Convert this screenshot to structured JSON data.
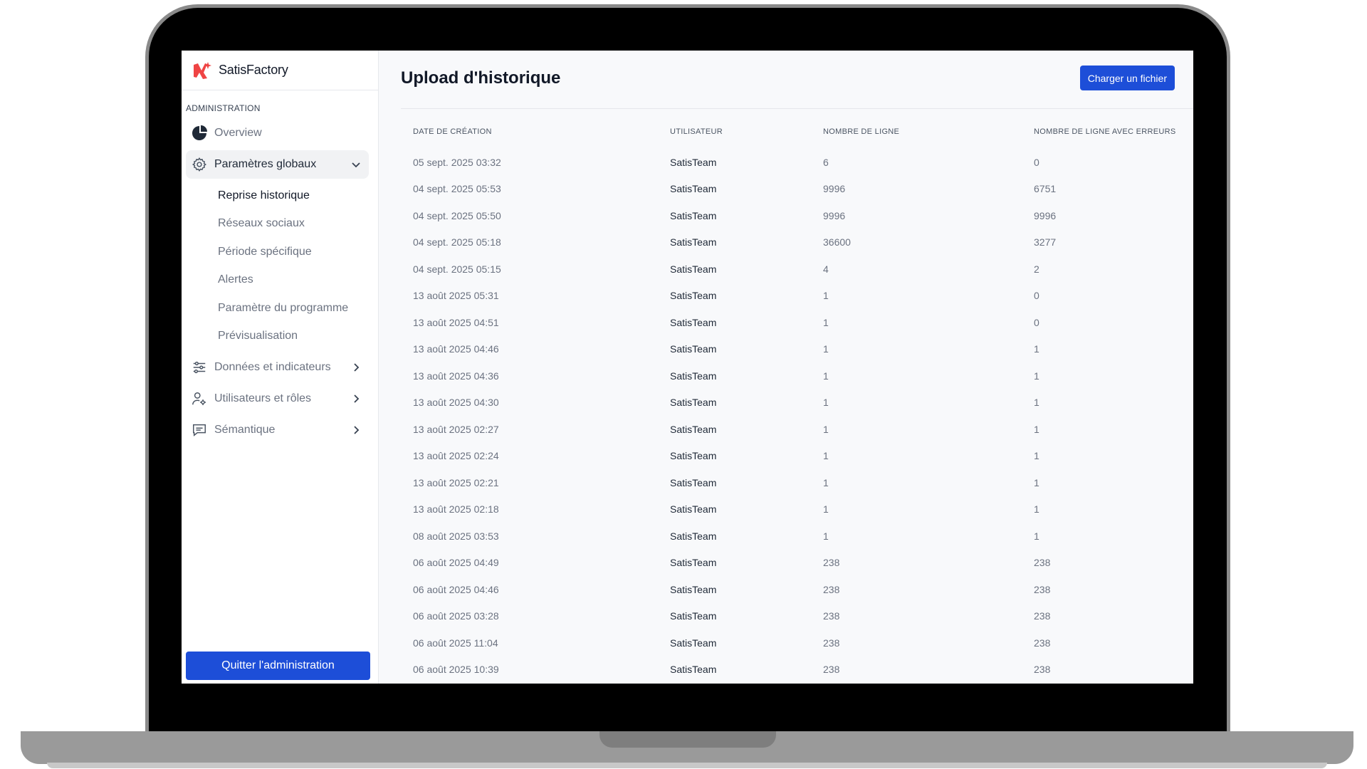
{
  "brand": {
    "name": "SatisFactory"
  },
  "sidebar": {
    "section_label": "ADMINISTRATION",
    "items": [
      {
        "label": "Overview",
        "icon": "pie-chart-icon"
      },
      {
        "label": "Paramètres globaux",
        "icon": "gear-icon",
        "expanded": true
      },
      {
        "label": "Données et indicateurs",
        "icon": "sliders-icon"
      },
      {
        "label": "Utilisateurs et rôles",
        "icon": "user-gear-icon"
      },
      {
        "label": "Sémantique",
        "icon": "chat-icon"
      }
    ],
    "subitems": [
      {
        "label": "Reprise historique",
        "current": true
      },
      {
        "label": "Réseaux sociaux"
      },
      {
        "label": "Période spécifique"
      },
      {
        "label": "Alertes"
      },
      {
        "label": "Paramètre du programme"
      },
      {
        "label": "Prévisualisation"
      }
    ],
    "quit_label": "Quitter l'administration"
  },
  "main": {
    "title": "Upload d'historique",
    "upload_label": "Charger un fichier",
    "columns": [
      "DATE DE CRÉATION",
      "UTILISATEUR",
      "NOMBRE DE LIGNE",
      "NOMBRE DE LIGNE AVEC ERREURS"
    ],
    "rows": [
      [
        "05 sept. 2025 03:32",
        "SatisTeam",
        "6",
        "0"
      ],
      [
        "04 sept. 2025 05:53",
        "SatisTeam",
        "9996",
        "6751"
      ],
      [
        "04 sept. 2025 05:50",
        "SatisTeam",
        "9996",
        "9996"
      ],
      [
        "04 sept. 2025 05:18",
        "SatisTeam",
        "36600",
        "3277"
      ],
      [
        "04 sept. 2025 05:15",
        "SatisTeam",
        "4",
        "2"
      ],
      [
        "13 août 2025 05:31",
        "SatisTeam",
        "1",
        "0"
      ],
      [
        "13 août 2025 04:51",
        "SatisTeam",
        "1",
        "0"
      ],
      [
        "13 août 2025 04:46",
        "SatisTeam",
        "1",
        "1"
      ],
      [
        "13 août 2025 04:36",
        "SatisTeam",
        "1",
        "1"
      ],
      [
        "13 août 2025 04:30",
        "SatisTeam",
        "1",
        "1"
      ],
      [
        "13 août 2025 02:27",
        "SatisTeam",
        "1",
        "1"
      ],
      [
        "13 août 2025 02:24",
        "SatisTeam",
        "1",
        "1"
      ],
      [
        "13 août 2025 02:21",
        "SatisTeam",
        "1",
        "1"
      ],
      [
        "13 août 2025 02:18",
        "SatisTeam",
        "1",
        "1"
      ],
      [
        "08 août 2025 03:53",
        "SatisTeam",
        "1",
        "1"
      ],
      [
        "06 août 2025 04:49",
        "SatisTeam",
        "238",
        "238"
      ],
      [
        "06 août 2025 04:46",
        "SatisTeam",
        "238",
        "238"
      ],
      [
        "06 août 2025 03:28",
        "SatisTeam",
        "238",
        "238"
      ],
      [
        "06 août 2025 11:04",
        "SatisTeam",
        "238",
        "238"
      ],
      [
        "06 août 2025 10:39",
        "SatisTeam",
        "238",
        "238"
      ]
    ]
  },
  "colors": {
    "accent": "#1d4ed8",
    "logo_red": "#ef4444"
  }
}
